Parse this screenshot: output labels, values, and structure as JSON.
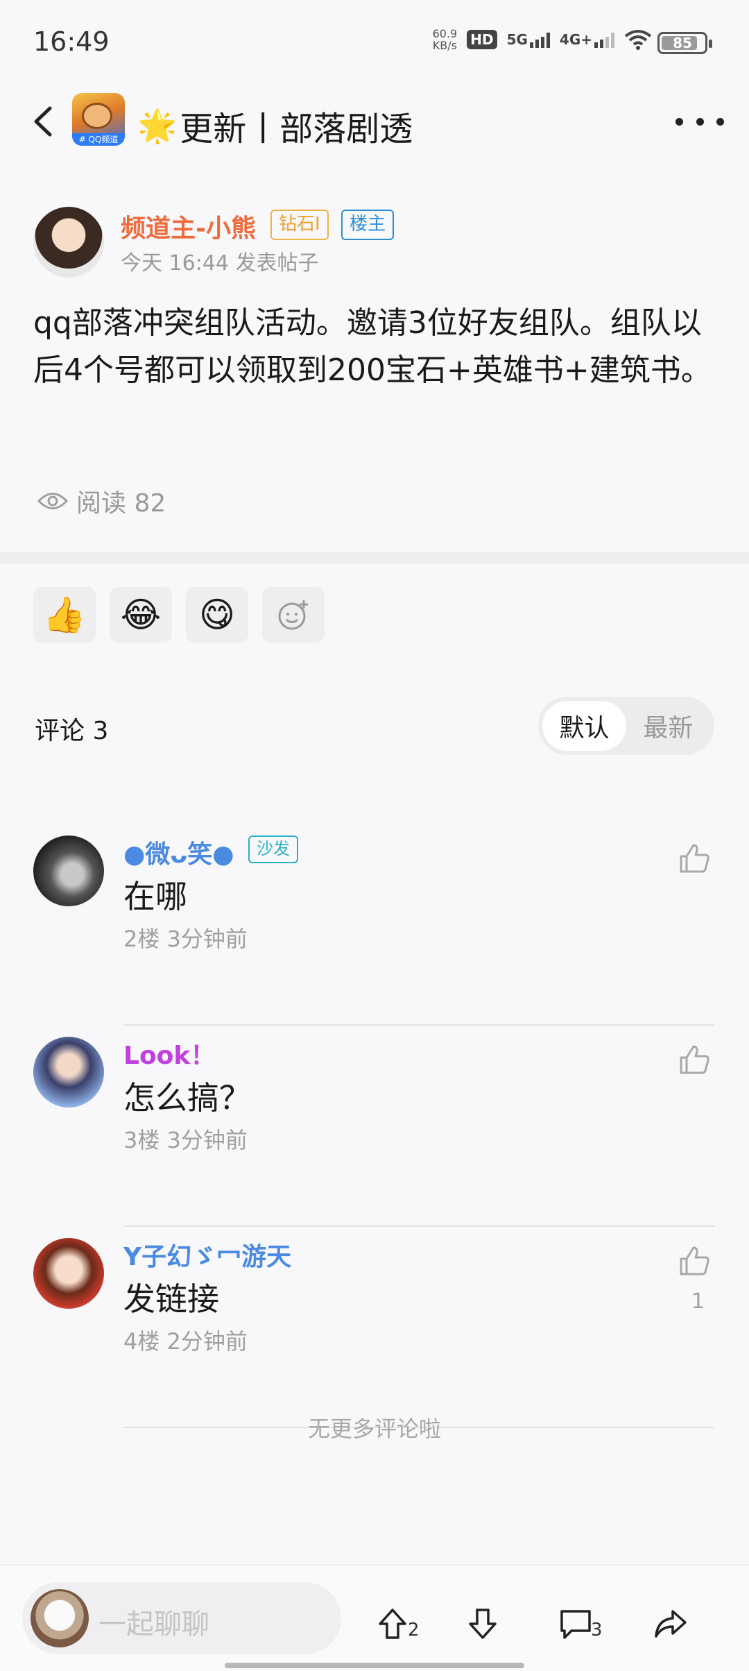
{
  "status_bar": {
    "time": "16:49",
    "net_speed_value": "60.9",
    "net_speed_unit": "KB/s",
    "hd": "HD",
    "network_1": "5G",
    "network_2": "4G+",
    "battery": "85"
  },
  "header": {
    "app_icon_badge": "# QQ频道",
    "title": "更新丨部落剧透",
    "title_emoji": "🌟"
  },
  "post": {
    "author": "频道主-小熊",
    "tag_diamond": "钻石Ⅰ",
    "tag_owner": "楼主",
    "time": "今天 16:44 发表帖子",
    "content": "qq部落冲突组队活动。邀请3位好友组队。组队以后4个号都可以领取到200宝石+英雄书+建筑书。",
    "read_label": "阅读 82"
  },
  "reactions": [
    "👍",
    "😂",
    "😋"
  ],
  "comments_section": {
    "title": "评论  3",
    "sort_default": "默认",
    "sort_latest": "最新",
    "no_more": "无更多评论啦"
  },
  "comments": [
    {
      "name": "●微ᴗ笑●",
      "name_color": "#4a8ae0",
      "badge": "沙发",
      "text": "在哪",
      "meta": "2楼 3分钟前",
      "likes": ""
    },
    {
      "name": "Look！",
      "name_color": "#c040e0",
      "badge": "",
      "text": "怎么搞？",
      "meta": "3楼 3分钟前",
      "likes": ""
    },
    {
      "name": "Y子幻ゞ冖游天",
      "name_color": "#4a8ae0",
      "badge": "",
      "text": "发链接",
      "meta": "4楼 2分钟前",
      "likes": "1"
    }
  ],
  "bottom_bar": {
    "input_placeholder": "一起聊聊",
    "up_count": "2",
    "comment_count": "3"
  }
}
